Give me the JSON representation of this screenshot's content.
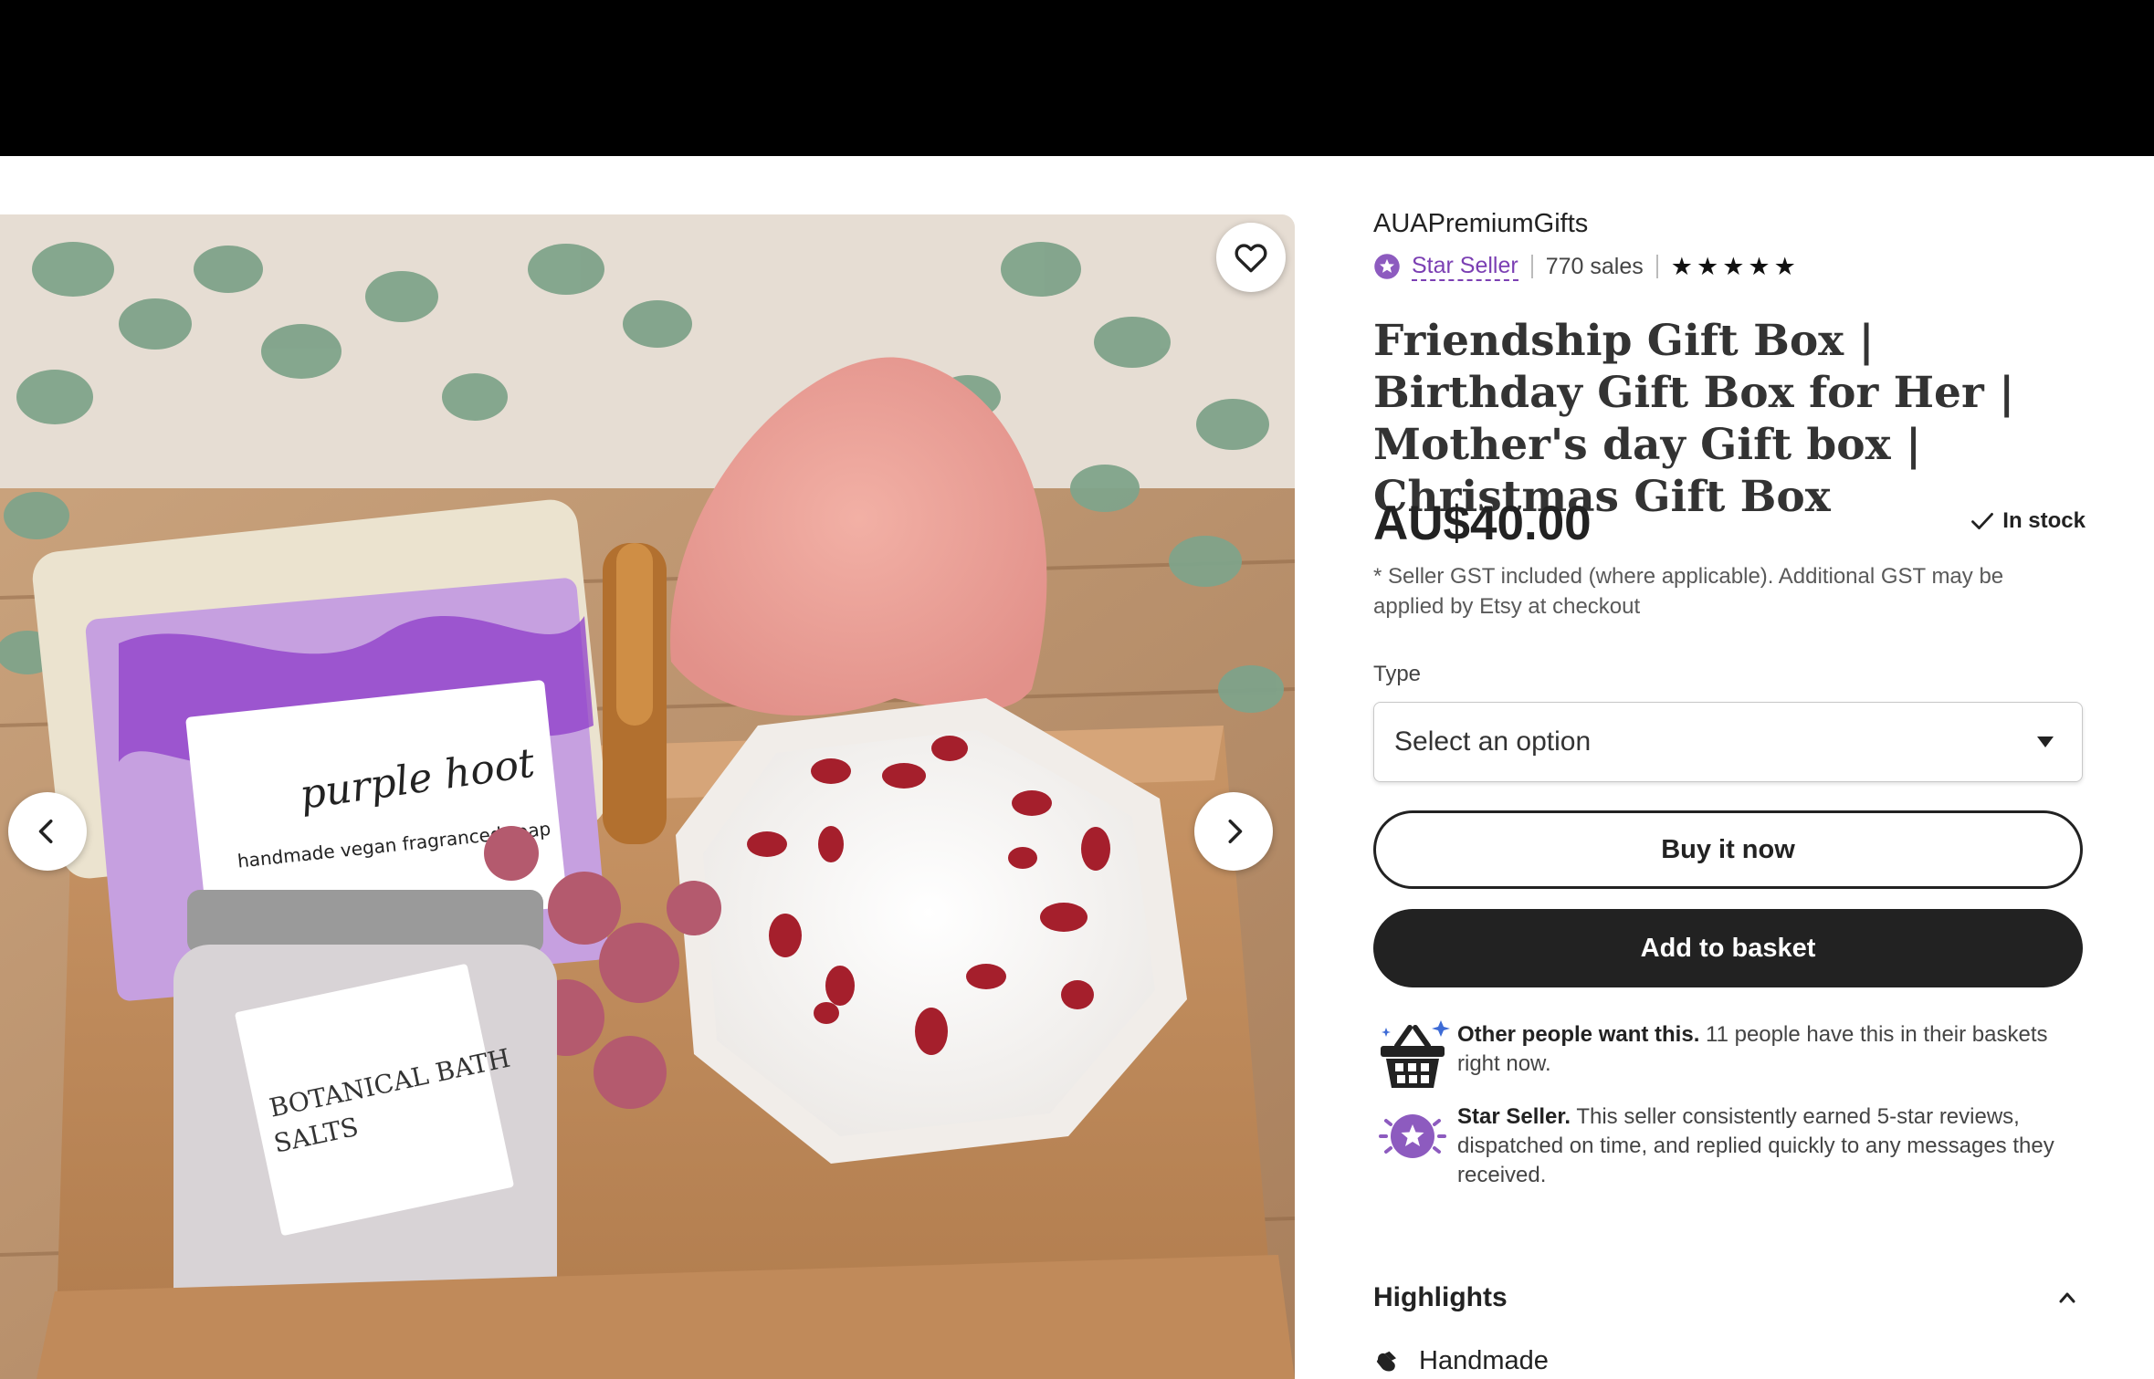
{
  "listing": {
    "shop_name": "AUAPremiumGifts",
    "star_seller_label": "Star Seller",
    "sales": "770 sales",
    "rating_stars": 5,
    "title": "Friendship Gift Box | Birthday Gift Box for Her | Mother's day Gift box | Christmas Gift Box",
    "price": "AU$40.00",
    "stock_status": "In stock",
    "gst_note": "* Seller GST included (where applicable). Additional GST may be applied by Etsy at checkout"
  },
  "variation": {
    "label": "Type",
    "selected": "Select an option"
  },
  "actions": {
    "buy_now": "Buy it now",
    "add_to_basket": "Add to basket"
  },
  "signals": {
    "demand_bold": "Other people want this.",
    "demand_text": " 11 people have this in their baskets right now.",
    "star_bold": "Star Seller.",
    "star_text": " This seller consistently earned 5-star reviews, dispatched on time, and replied quickly to any messages they received."
  },
  "highlights": {
    "title": "Highlights",
    "items": [
      "Handmade"
    ]
  },
  "gallery": {
    "icons": [
      "heart-icon",
      "chevron-left-icon",
      "chevron-right-icon"
    ]
  },
  "colors": {
    "accent_purple": "#7b3fb3",
    "primary_button": "#222222",
    "top_bar": "#000000"
  }
}
